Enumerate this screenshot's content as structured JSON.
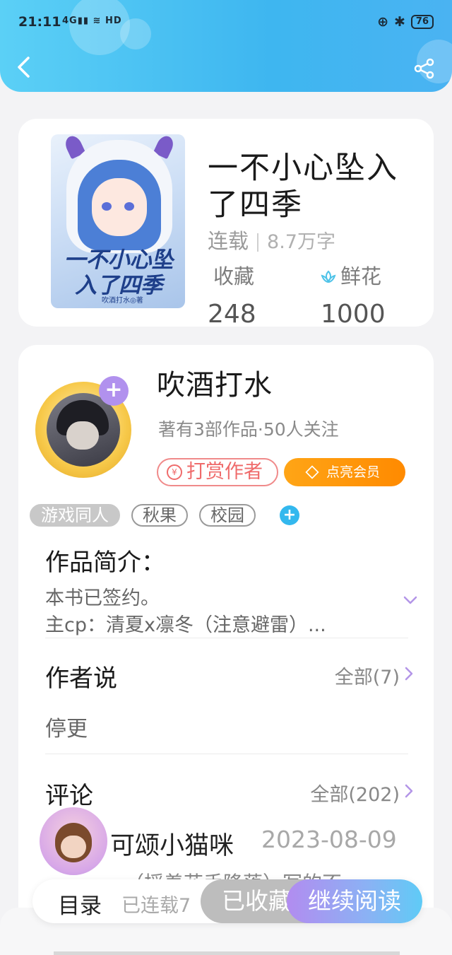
{
  "status_bar": {
    "time": "21:11",
    "network": "4G",
    "hd": "HD",
    "battery": "76"
  },
  "book": {
    "cover_title": "一不小心坠入了四季",
    "cover_author": "吹酒打水◎著",
    "title": "一不小心坠入了四季",
    "status": "连载",
    "word_count": "8.7万字",
    "favorites_label": "收藏",
    "favorites_value": "248",
    "flowers_label": "鲜花",
    "flowers_value": "1000"
  },
  "author": {
    "name": "吹酒打水",
    "stats": "著有3部作品·50人关注",
    "tip_label": "打赏作者",
    "vip_label": "点亮会员"
  },
  "tags": [
    "游戏同人",
    "秋果",
    "校园"
  ],
  "intro": {
    "title": "作品简介：",
    "line1": "本书已签约。",
    "line2": "主cp：清夏x凛冬（注意避雷）..."
  },
  "author_says": {
    "title": "作者说",
    "all_link": "全部(7)",
    "text": "停更"
  },
  "comments": {
    "title": "评论",
    "all_link": "全部(202)",
    "first": {
      "user": "可颂小猫咪",
      "date": "2023-08-09",
      "snippet": "（摇着花手降落）写的不"
    }
  },
  "bottom_bar": {
    "toc": "目录",
    "serial": "已连载7",
    "collected": "已收藏",
    "continue": "继续阅读"
  },
  "colors": {
    "header": "#3eb6f0",
    "accent_purple": "#b191ee",
    "tip_red": "#ef6b6b",
    "vip_orange": "#ff8a00"
  }
}
